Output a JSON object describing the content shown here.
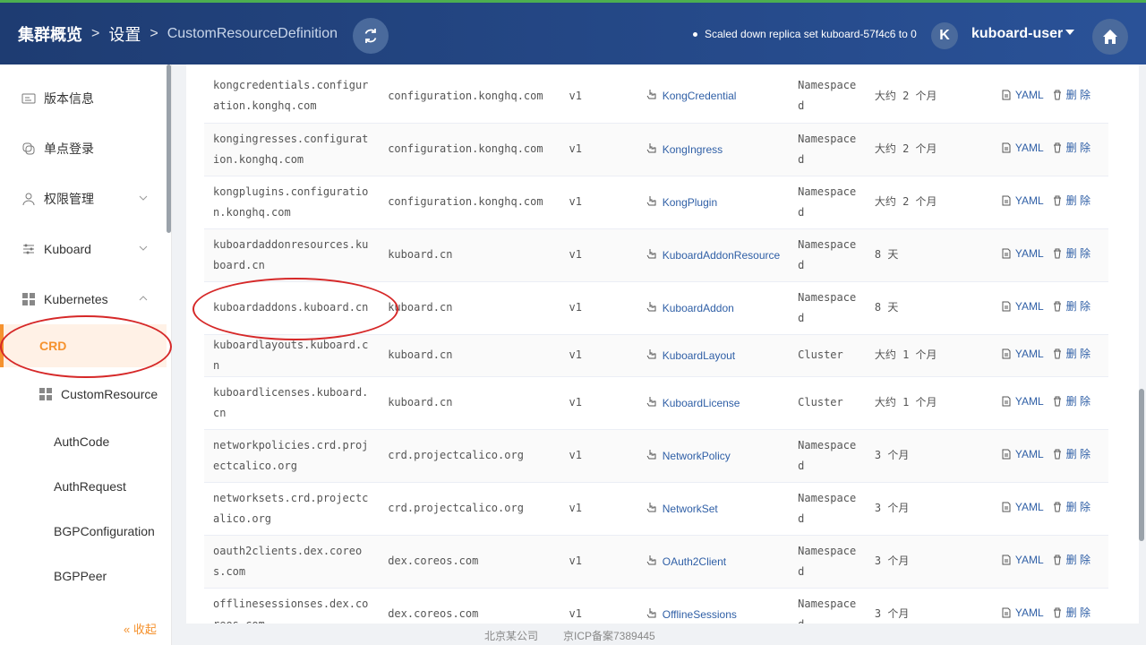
{
  "header": {
    "breadcrumb": [
      "集群概览",
      "设置",
      "CustomResourceDefinition"
    ],
    "event_message": "Scaled down replica set kuboard-57f4c6 to 0",
    "user_avatar_letter": "K",
    "user_name": "kuboard-user"
  },
  "sidebar": {
    "items": [
      {
        "label": "版本信息",
        "icon": "version-icon"
      },
      {
        "label": "单点登录",
        "icon": "sso-icon"
      },
      {
        "label": "权限管理",
        "icon": "user-icon"
      },
      {
        "label": "Kuboard",
        "icon": "sliders-icon"
      },
      {
        "label": "Kubernetes",
        "icon": "grid-icon"
      }
    ],
    "active_item": "CRD",
    "sub_items": [
      "CustomResource",
      "AuthCode",
      "AuthRequest",
      "BGPConfiguration",
      "BGPPeer"
    ],
    "collapse_label": "« 收起"
  },
  "table": {
    "yaml_label": "YAML",
    "delete_label": "删 除",
    "rows": [
      {
        "name": "kongcredentials.configuration.konghq.com",
        "group": "configuration.konghq.com",
        "version": "v1",
        "kind": "KongCredential",
        "scope": "Namespaced",
        "age": "大约 2 个月"
      },
      {
        "name": "kongingresses.configuration.konghq.com",
        "group": "configuration.konghq.com",
        "version": "v1",
        "kind": "KongIngress",
        "scope": "Namespaced",
        "age": "大约 2 个月"
      },
      {
        "name": "kongplugins.configuration.konghq.com",
        "group": "configuration.konghq.com",
        "version": "v1",
        "kind": "KongPlugin",
        "scope": "Namespaced",
        "age": "大约 2 个月"
      },
      {
        "name": "kuboardaddonresources.kuboard.cn",
        "group": "kuboard.cn",
        "version": "v1",
        "kind": "KuboardAddonResource",
        "scope": "Namespaced",
        "age": "8 天"
      },
      {
        "name": "kuboardaddons.kuboard.cn",
        "group": "kuboard.cn",
        "version": "v1",
        "kind": "KuboardAddon",
        "scope": "Namespaced",
        "age": "8 天"
      },
      {
        "name": "kuboardlayouts.kuboard.cn",
        "group": "kuboard.cn",
        "version": "v1",
        "kind": "KuboardLayout",
        "scope": "Cluster",
        "age": "大约 1 个月"
      },
      {
        "name": "kuboardlicenses.kuboard.cn",
        "group": "kuboard.cn",
        "version": "v1",
        "kind": "KuboardLicense",
        "scope": "Cluster",
        "age": "大约 1 个月"
      },
      {
        "name": "networkpolicies.crd.projectcalico.org",
        "group": "crd.projectcalico.org",
        "version": "v1",
        "kind": "NetworkPolicy",
        "scope": "Namespaced",
        "age": "3 个月"
      },
      {
        "name": "networksets.crd.projectcalico.org",
        "group": "crd.projectcalico.org",
        "version": "v1",
        "kind": "NetworkSet",
        "scope": "Namespaced",
        "age": "3 个月"
      },
      {
        "name": "oauth2clients.dex.coreos.com",
        "group": "dex.coreos.com",
        "version": "v1",
        "kind": "OAuth2Client",
        "scope": "Namespaced",
        "age": "3 个月"
      },
      {
        "name": "offlinesessionses.dex.coreos.com",
        "group": "dex.coreos.com",
        "version": "v1",
        "kind": "OfflineSessions",
        "scope": "Namespaced",
        "age": "3 个月"
      }
    ]
  },
  "footer": {
    "company": "北京某公司",
    "icp": "京ICP备案7389445"
  },
  "colors": {
    "header_bg": "#1e3c72",
    "accent": "#f5922e",
    "link": "#2f5fa6",
    "highlight": "#d62828"
  }
}
